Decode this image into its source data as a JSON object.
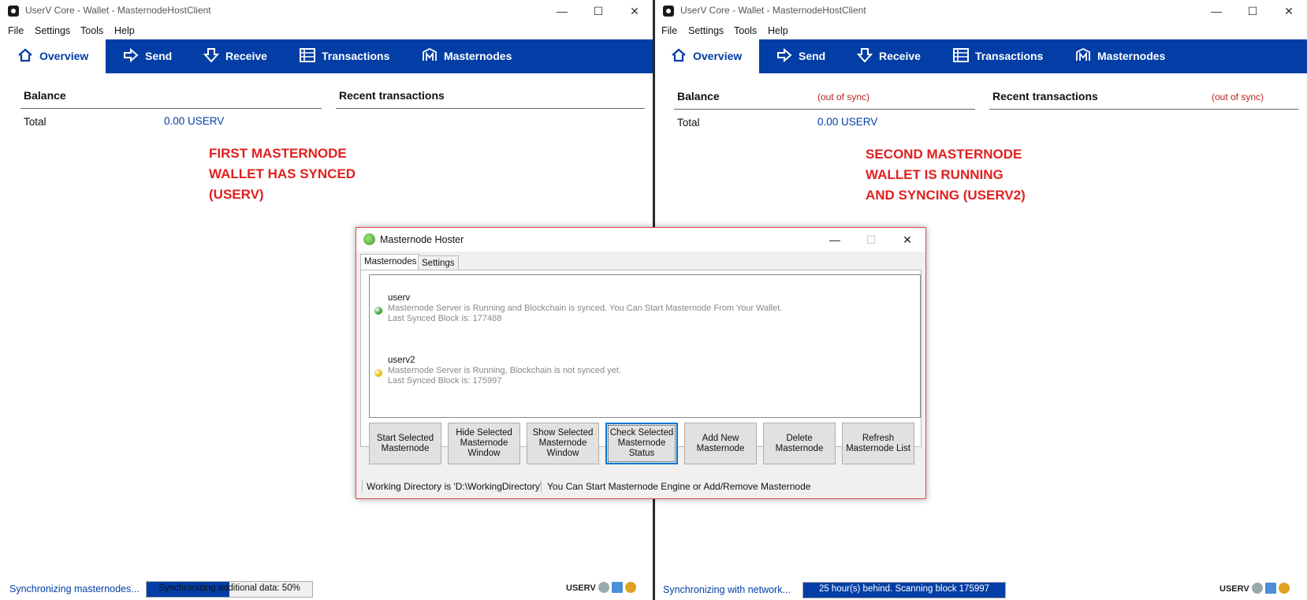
{
  "windows": [
    {
      "title": "UserV Core - Wallet - MasternodeHostClient",
      "menu": [
        "File",
        "Settings",
        "Tools",
        "Help"
      ],
      "tabs": [
        "Overview",
        "Send",
        "Receive",
        "Transactions",
        "Masternodes"
      ],
      "balance_label": "Balance",
      "recent_label": "Recent transactions",
      "balance_sync_note": "",
      "recent_sync_note": "",
      "total_label": "Total",
      "total_value": "0.00 USERV",
      "annotation": "FIRST MASTERNODE\nWALLET HAS SYNCED\n(USERV)",
      "status_text": "Synchronizing masternodes...",
      "progress_text": "Synchronizing additional data: 50%",
      "progress_fraction": 0.5,
      "unit": "USERV"
    },
    {
      "title": "UserV Core - Wallet - MasternodeHostClient",
      "menu": [
        "File",
        "Settings",
        "Tools",
        "Help"
      ],
      "tabs": [
        "Overview",
        "Send",
        "Receive",
        "Transactions",
        "Masternodes"
      ],
      "balance_label": "Balance",
      "recent_label": "Recent transactions",
      "balance_sync_note": "(out of sync)",
      "recent_sync_note": "(out of sync)",
      "total_label": "Total",
      "total_value": "0.00 USERV",
      "annotation": "SECOND MASTERNODE\nWALLET IS RUNNING\nAND SYNCING (USERV2)",
      "status_text": "Synchronizing with network...",
      "progress_text": "25 hour(s) behind. Scanning block 175997",
      "progress_fraction": 1,
      "unit": "USERV"
    }
  ],
  "dialog": {
    "title": "Masternode Hoster",
    "tabs": [
      "Masternodes",
      "Settings"
    ],
    "masternodes": [
      {
        "name": "userv",
        "status": "Masternode Server is Running and Blockchain is synced. You Can Start Masternode From Your Wallet.",
        "block": "Last Synced Block is: 177488",
        "color": "#2aa52a"
      },
      {
        "name": "userv2",
        "status": "Masternode Server is Running, Blockchain is not synced yet.",
        "block": "Last Synced Block is: 175997",
        "color": "#e6b800"
      }
    ],
    "buttons": [
      "Start Selected\nMasternode",
      "Hide Selected\nMasternode\nWindow",
      "Show Selected\nMasternode\nWindow",
      "Check Selected\nMasternode\nStatus",
      "Add New\nMasternode",
      "Delete\nMasternode",
      "Refresh\nMasternode List"
    ],
    "status_left": "Working Directory is 'D:\\WorkingDirectory'",
    "status_right": "You Can Start Masternode Engine or Add/Remove Masternode"
  }
}
